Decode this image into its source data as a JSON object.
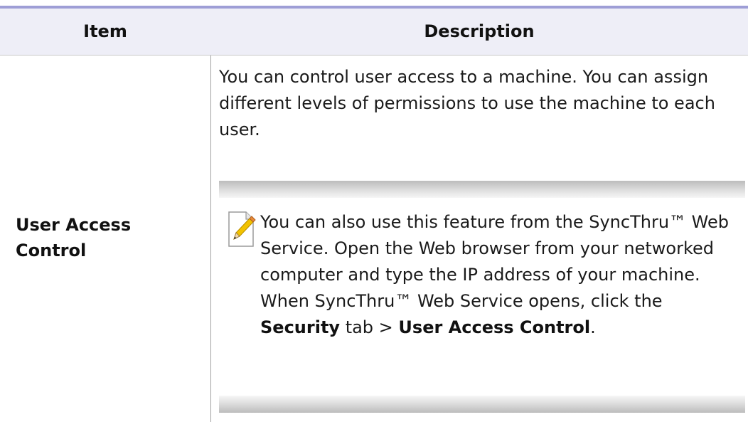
{
  "table": {
    "headers": {
      "item": "Item",
      "description": "Description"
    },
    "row": {
      "item": "User Access Control",
      "description": "You can control user access to a machine. You can assign different levels of permissions to use the machine to each user.",
      "note": {
        "icon": "note-pencil-icon",
        "text_before": " You can also use this feature from the SyncThru™ Web Service. Open the Web browser from your networked computer and type the IP address of your machine. When SyncThru™ Web Service opens, click the ",
        "bold_1": "Security",
        "text_middle": " tab > ",
        "bold_2": "User Access Control",
        "text_after": "."
      }
    }
  },
  "colors": {
    "header_rule": "#9e9ed6",
    "header_bg": "#eeeef7"
  }
}
